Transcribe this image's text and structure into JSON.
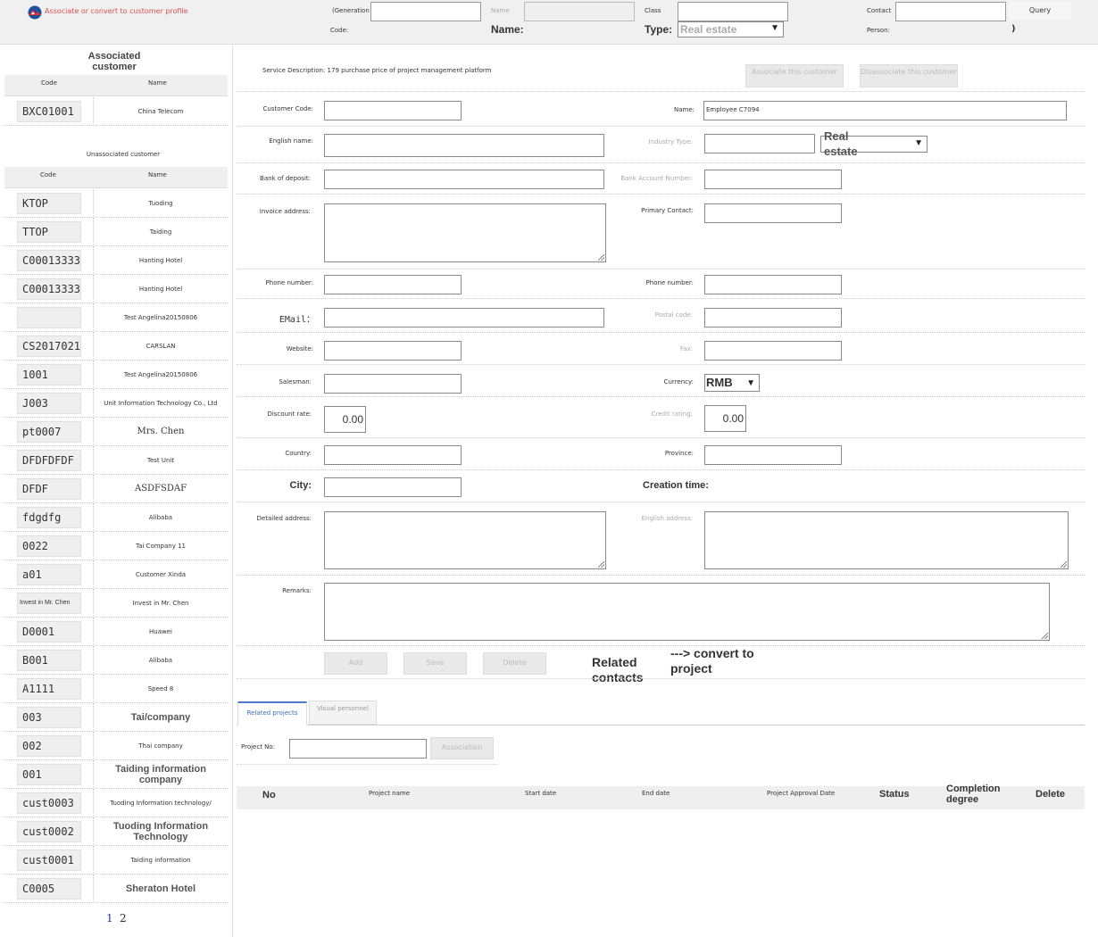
{
  "topbar": {
    "title": "Associate or convert to customer profile",
    "generation_label": "(Generation",
    "code_label": "Code:",
    "name_label_small": "Name",
    "name_label_big": "Name:",
    "class_label": "Class",
    "type_label": "Type:",
    "type_value": "Real estate",
    "contact_label": "Contact",
    "person_label": "Person:",
    "paren": ")",
    "query_label": "Query"
  },
  "associated": {
    "heading": "Associated customer",
    "col_code": "Code",
    "col_name": "Name",
    "rows": [
      {
        "code": "BXC01001",
        "name": "China Telecom"
      }
    ]
  },
  "unassociated": {
    "heading": "Unassociated customer",
    "col_code": "Code",
    "col_name": "Name",
    "rows": [
      {
        "code": "KTOP",
        "name": "Tuoding"
      },
      {
        "code": "TTOP",
        "name": "Taiding"
      },
      {
        "code": "C00013333",
        "name": "Hanting Hotel"
      },
      {
        "code": "C00013333",
        "name": "Hanting Hotel"
      },
      {
        "code": "",
        "name": "Test Angelina20150806"
      },
      {
        "code": "CS2017021",
        "name": "CARSLAN"
      },
      {
        "code": "1001",
        "name": "Test Angelina20150806"
      },
      {
        "code": "J003",
        "name": "Unit Information Technology Co., Ltd"
      },
      {
        "code": "pt0007",
        "name": "Mrs. Chen"
      },
      {
        "code": "DFDFDFDF",
        "name": "Test Unit"
      },
      {
        "code": "DFDF",
        "name": "ASDFSDAF"
      },
      {
        "code": "fdgdfg",
        "name": "Alibaba"
      },
      {
        "code": "0022",
        "name": "Tai Company 11"
      },
      {
        "code": "a01",
        "name": "Customer Xinda"
      },
      {
        "code": "Invest in Mr. Chen",
        "name": "Invest in Mr. Chen"
      },
      {
        "code": "D0001",
        "name": "Huawei"
      },
      {
        "code": "B001",
        "name": "Alibaba"
      },
      {
        "code": "A1111",
        "name": "Speed 8"
      },
      {
        "code": "003",
        "name": "Tai/company"
      },
      {
        "code": "002",
        "name": "Thai company"
      },
      {
        "code": "001",
        "name": "Taiding information company"
      },
      {
        "code": "cust0003",
        "name": "Tuoding Information technology/"
      },
      {
        "code": "cust0002",
        "name": "Tuoding Information Technology"
      },
      {
        "code": "cust0001",
        "name": "Taiding information"
      },
      {
        "code": "C0005",
        "name": "Sheraton Hotel"
      }
    ],
    "pages": [
      "1",
      "2"
    ]
  },
  "form": {
    "service_description": "Service Description: 179 purchase price of project management platform",
    "associate_btn": "Associate this customer",
    "disassociate_btn": "Disassociate this customer",
    "customer_code_label": "Customer Code:",
    "name_label": "Name:",
    "name_value": "Employee C7094",
    "english_name_label": "English name:",
    "industry_type_label": "Industry Type:",
    "industry_type_value": "Real estate",
    "bank_label": "Bank of deposit:",
    "bank_account_label": "Bank Account Number:",
    "invoice_address_label": "Invoice address:",
    "primary_contact_label": "Primary Contact:",
    "phone_label_1": "Phone number:",
    "phone_label_2": "Phone number:",
    "email_label": "EMail：",
    "postal_label": "Postal code:",
    "website_label": "Website:",
    "fax_label": "Fax:",
    "salesman_label": "Salesman:",
    "currency_label": "Currency:",
    "currency_value": "RMB",
    "discount_label": "Discount rate:",
    "discount_value": "0.00",
    "credit_label": "Credit rating:",
    "credit_value": "0.00",
    "country_label": "Country:",
    "province_label": "Province:",
    "city_label": "City:",
    "creation_time_label": "Creation time:",
    "detailed_address_label": "Detailed address:",
    "english_address_label": "English address:",
    "remarks_label": "Remarks:",
    "add_btn": "Add",
    "save_btn": "Save",
    "delete_btn": "Delete",
    "related_contacts": "Related contacts",
    "convert_link": "---> convert to project"
  },
  "tabs": [
    {
      "label": "Related projects"
    },
    {
      "label": "Visual personnel"
    }
  ],
  "projects": {
    "project_no_label": "Project No:",
    "association_btn": "Association",
    "columns": [
      "No",
      "Project name",
      "Start date",
      "End date",
      "Project Approval Date",
      "Status",
      "Completion degree",
      "Delete"
    ]
  }
}
